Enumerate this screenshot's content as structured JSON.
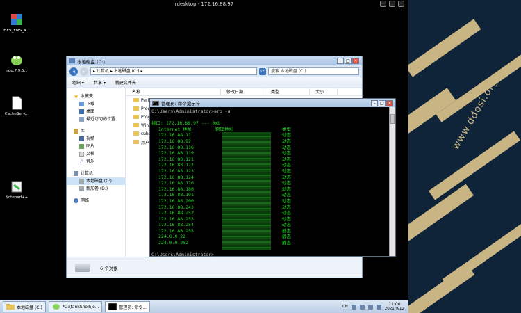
{
  "rdesktop": {
    "title": "rdesktop - 172.16.88.97"
  },
  "desktop_icons": [
    {
      "label": "HEV_EMS_A..."
    },
    {
      "label": "npp.7.9.5..."
    },
    {
      "label": "CacheServ..."
    },
    {
      "label": "Notepad++"
    }
  ],
  "explorer": {
    "title": "本地磁盘 (C:)",
    "address": "▸ 计算机 ▸ 本地磁盘 (C:) ▸",
    "search_placeholder": "搜索 本地磁盘 (C:)",
    "toolbar": {
      "organize": "组织 ▾",
      "share": "共享 ▾",
      "new_folder": "新建文件夹"
    },
    "columns": {
      "name": "名称",
      "modified": "修改日期",
      "type": "类型",
      "size": "大小"
    },
    "files": [
      "Perf",
      "Prog",
      "Prog",
      "Wind",
      "subb",
      "用户"
    ],
    "nav": {
      "favorites": "收藏夹",
      "downloads": "下载",
      "desktop": "桌面",
      "recent": "最近访问的位置",
      "libraries": "库",
      "videos": "视频",
      "pictures": "图片",
      "documents": "文档",
      "music": "音乐",
      "computer": "计算机",
      "local_disk": "本地磁盘 (C:)",
      "new_volume": "新加卷 (D:)",
      "network": "网络"
    },
    "status": "6 个对象"
  },
  "cmd": {
    "title": "管理员: 命令提示符",
    "command_line": "C:\\Users\\Administrator>arp -a",
    "interface_line": "接口: 172.16.88.97 --- 0xb",
    "headers": {
      "ip": "Internet 地址",
      "mac": "物理地址",
      "type": "类型"
    },
    "rows": [
      {
        "ip": "172.16.88.11",
        "type": "动态"
      },
      {
        "ip": "172.16.88.92",
        "type": "动态"
      },
      {
        "ip": "172.16.88.116",
        "type": "动态"
      },
      {
        "ip": "172.16.88.119",
        "type": "动态"
      },
      {
        "ip": "172.16.88.121",
        "type": "动态"
      },
      {
        "ip": "172.16.88.122",
        "type": "动态"
      },
      {
        "ip": "172.16.88.123",
        "type": "动态"
      },
      {
        "ip": "172.16.88.124",
        "type": "动态"
      },
      {
        "ip": "172.16.88.176",
        "type": "动态"
      },
      {
        "ip": "172.16.88.180",
        "type": "动态"
      },
      {
        "ip": "172.16.88.191",
        "type": "动态"
      },
      {
        "ip": "172.16.88.200",
        "type": "动态"
      },
      {
        "ip": "172.16.88.243",
        "type": "动态"
      },
      {
        "ip": "172.16.88.252",
        "type": "动态"
      },
      {
        "ip": "172.16.88.253",
        "type": "动态"
      },
      {
        "ip": "172.16.88.254",
        "type": "动态"
      },
      {
        "ip": "172.16.88.255",
        "type": "静态"
      },
      {
        "ip": "224.0.0.22",
        "type": "静态"
      },
      {
        "ip": "224.0.0.252",
        "type": "静态"
      }
    ],
    "prompt": "C:\\Users\\Administrator>_"
  },
  "taskbar": {
    "items": [
      {
        "label": "本地磁盘 (C:)"
      },
      {
        "label": "*D:\\tankShell\\lo..."
      },
      {
        "label": "管理员: 命令..."
      }
    ],
    "lang": "CN",
    "time": "11:00",
    "date": "2021/9/12"
  },
  "wallpaper": {
    "watermark": "www.ddosi.org"
  }
}
